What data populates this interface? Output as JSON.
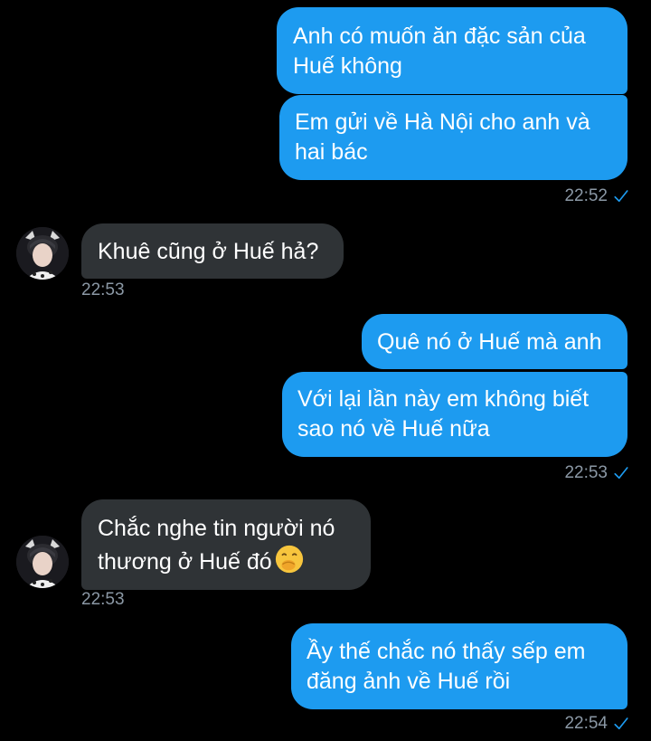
{
  "colors": {
    "background": "#000000",
    "sent_bubble": "#1d9bf0",
    "received_bubble": "#2f3336",
    "timestamp": "#8b98a5",
    "read_check": "#1d9bf0"
  },
  "messages": [
    {
      "id": "m1",
      "direction": "sent",
      "text": "Anh có muốn ăn đặc sản của Huế không"
    },
    {
      "id": "m2",
      "direction": "sent",
      "text": "Em gửi về Hà Nội cho anh và hai bác",
      "time": "22:52",
      "status_icon": "read-check-icon"
    },
    {
      "id": "m3",
      "direction": "received",
      "text": "Khuê cũng ở Huế hả?",
      "time": "22:53",
      "avatar": "contact-avatar"
    },
    {
      "id": "m4",
      "direction": "sent",
      "text": "Quê nó ở Huế mà anh"
    },
    {
      "id": "m5",
      "direction": "sent",
      "text": "Với lại lần này em không biết sao nó về Huế nữa",
      "time": "22:53",
      "status_icon": "read-check-icon"
    },
    {
      "id": "m6",
      "direction": "received",
      "text": "Chắc nghe tin người nó thương ở Huế đó",
      "emoji": "face-with-hand-over-mouth-emoji",
      "time": "22:53",
      "avatar": "contact-avatar"
    },
    {
      "id": "m7",
      "direction": "sent",
      "text": "Ầy thế chắc nó thấy sếp em đăng ảnh về Huế rồi",
      "time": "22:54",
      "status_icon": "read-check-icon"
    }
  ]
}
